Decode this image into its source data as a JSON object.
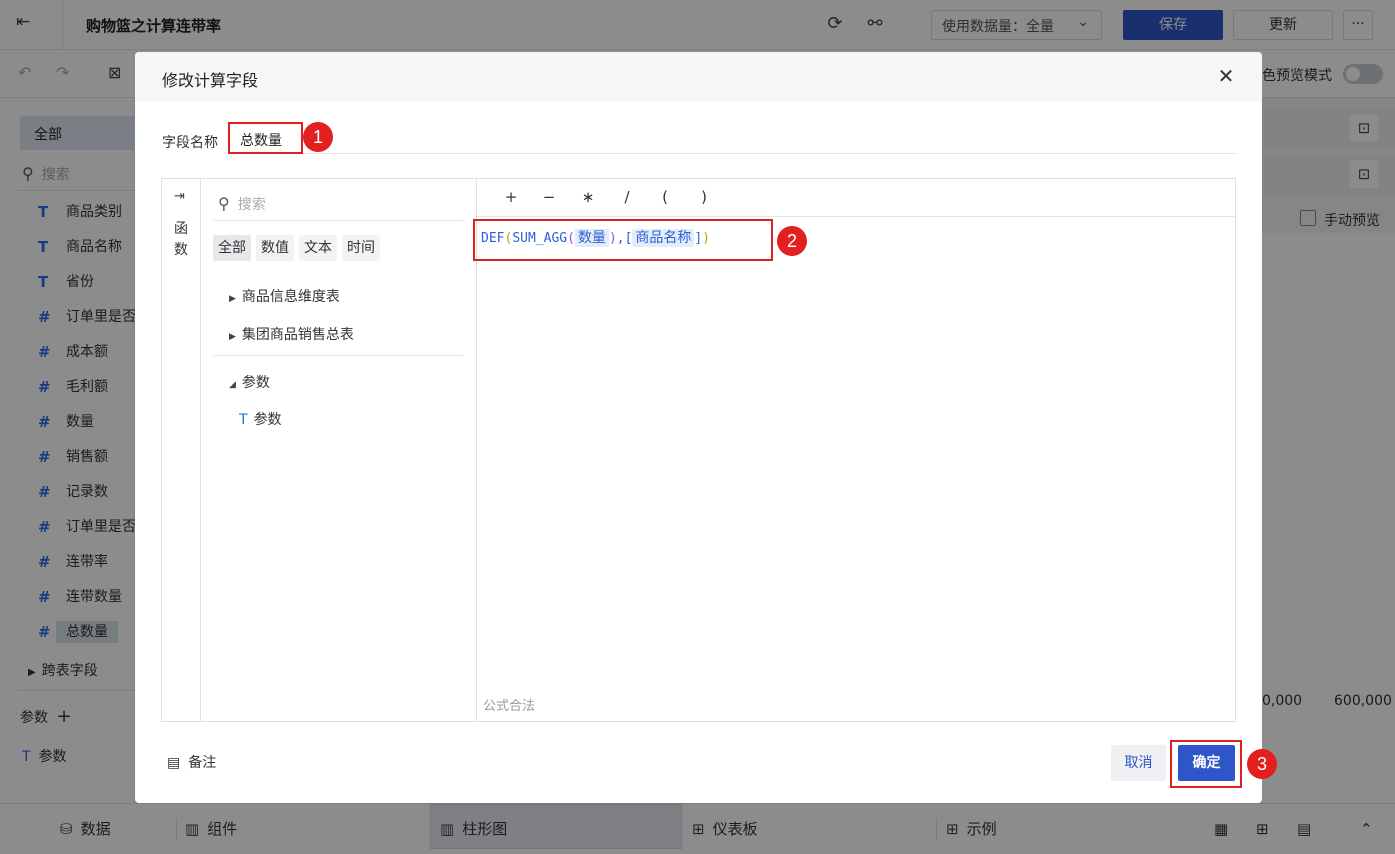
{
  "app": {
    "title": "购物篮之计算连带率",
    "data_usage_label": "使用数据量：全量",
    "save_label": "保存",
    "update_label": "更新",
    "more_label": "···",
    "preview_mode_label": "色预览模式"
  },
  "left_panel": {
    "tab_all": "全部",
    "search_placeholder": "搜索",
    "fields": [
      {
        "icon": "T",
        "label": "商品类别"
      },
      {
        "icon": "T",
        "label": "商品名称"
      },
      {
        "icon": "T",
        "label": "省份"
      },
      {
        "icon": "#",
        "label": "订单里是否"
      },
      {
        "icon": "#",
        "label": "成本额"
      },
      {
        "icon": "#",
        "label": "毛利额"
      },
      {
        "icon": "#",
        "label": "数量"
      },
      {
        "icon": "#",
        "label": "销售额"
      },
      {
        "icon": "#",
        "label": "记录数"
      },
      {
        "icon": "#",
        "label": "订单里是否"
      },
      {
        "icon": "#",
        "label": "连带率"
      },
      {
        "icon": "#",
        "label": "连带数量"
      },
      {
        "icon": "#",
        "label": "总数量"
      }
    ],
    "cross_table_label": "跨表字段",
    "params_header": "参数",
    "params_add": "+",
    "param_item": "参数"
  },
  "right_panel": {
    "manual_preview_label": "手动预览",
    "axis_tick_1": "0,000",
    "axis_tick_2": "600,000"
  },
  "bottom_bar": {
    "tabs": [
      "数据",
      "组件",
      "柱形图",
      "仪表板",
      "示例"
    ]
  },
  "dialog": {
    "title": "修改计算字段",
    "field_name_label": "字段名称",
    "field_name_value": "总数量",
    "function_rail_label": "函数",
    "search_placeholder": "搜索",
    "filter_chips": [
      "全部",
      "数值",
      "文本",
      "时间"
    ],
    "tree": {
      "table_1": "商品信息维度表",
      "table_2": "集团商品销售总表",
      "params_group": "参数",
      "params_leaf": "参数"
    },
    "operators": [
      "+",
      "−",
      "∗",
      "/",
      "(",
      ")"
    ],
    "formula": {
      "func_def": "DEF",
      "open_1": "(",
      "func_sum": "SUM_AGG",
      "open_2": "(",
      "field_1": "数量",
      "close_2": ")",
      "comma": ",",
      "open_bracket": "[",
      "field_2": "商品名称",
      "close_bracket": "]",
      "close_1": ")"
    },
    "validation_text": "公式合法",
    "note_label": "备注",
    "cancel_label": "取消",
    "ok_label": "确定",
    "callouts": [
      "1",
      "2",
      "3"
    ]
  }
}
